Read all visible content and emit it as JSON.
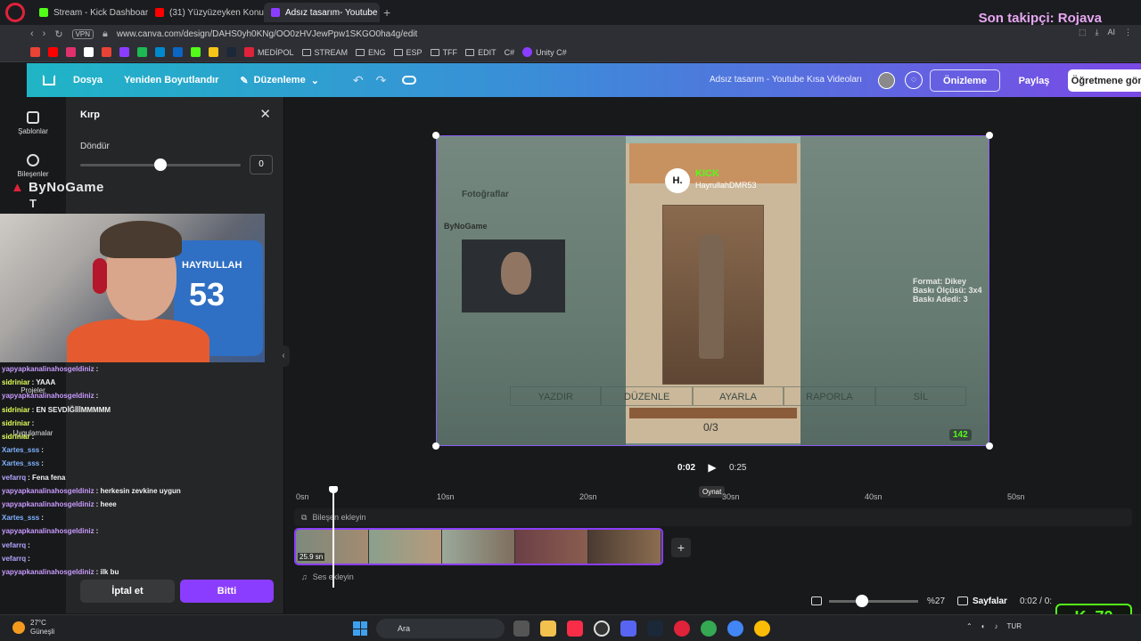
{
  "browser": {
    "tabs": [
      {
        "label": "Stream - Kick Dashboard",
        "color": "#53fc18"
      },
      {
        "label": "(31) Yüzyüzeyken Konu",
        "color": "#ff0000"
      },
      {
        "label": "Adsız tasarım- Youtube Kı",
        "color": "#8b3dff",
        "active": true
      }
    ],
    "url": "www.canva.com/design/DAHS0yh0KNg/OO0zHVJewPpw1SKGO0ha4g/edit",
    "vpn": "VPN",
    "bookmarks": [
      "MEDİPOL",
      "STREAM",
      "ENG",
      "ESP",
      "TFF",
      "EDIT",
      "C#",
      "Unity C#"
    ],
    "right_ai": "AI"
  },
  "overlay": {
    "follower": "Son takipçi: Rojava",
    "brand": "ByNoGame",
    "kick_viewers": "72"
  },
  "header": {
    "file": "Dosya",
    "resize": "Yeniden Boyutlandır",
    "edit": "Düzenleme",
    "doc_title": "Adsız tasarım - Youtube Kısa Videoları",
    "preview": "Önizleme",
    "share": "Paylaş",
    "send": "Öğretmene gönder"
  },
  "rail": {
    "templates": "Şablonlar",
    "elements": "Bileşenler",
    "projects": "Projeler",
    "apps": "Uygulamalar"
  },
  "crop_panel": {
    "title": "Kırp",
    "rotate_label": "Döndür",
    "rotate_value": "0",
    "slider_fraction": 0.5,
    "cancel": "İptal et",
    "done": "Bitti"
  },
  "webcam": {
    "jersey_name": "HAYRULLAH",
    "jersey_number": "53"
  },
  "chat": [
    {
      "user": "yapyapkanalinahosgeldiniz",
      "msg": ":",
      "color": "#c99bff"
    },
    {
      "user": "sidriniar",
      "msg": ": YAAA",
      "color": "#e4ff5a"
    },
    {
      "user": "yapyapkanalinahosgeldiniz",
      "msg": ":",
      "color": "#c99bff"
    },
    {
      "user": "sidriniar",
      "msg": ": EN SEVDİĞİİİMMMMM",
      "color": "#e4ff5a"
    },
    {
      "user": "sidriniar",
      "msg": ":",
      "color": "#e4ff5a"
    },
    {
      "user": "sidriniar",
      "msg": ":",
      "color": "#e4ff5a"
    },
    {
      "user": "Xartes_sss",
      "msg": ":",
      "color": "#7fb2ff"
    },
    {
      "user": "Xartes_sss",
      "msg": ":",
      "color": "#7fb2ff"
    },
    {
      "user": "vefarrq",
      "msg": ": Fena fena",
      "color": "#b5a6ff"
    },
    {
      "user": "yapyapkanalinahosgeldiniz",
      "msg": ": herkesin zevkine uygun",
      "color": "#c99bff"
    },
    {
      "user": "yapyapkanalinahosgeldiniz",
      "msg": ": heee",
      "color": "#c99bff"
    },
    {
      "user": "Xartes_sss",
      "msg": ":",
      "color": "#7fb2ff"
    },
    {
      "user": "yapyapkanalinahosgeldiniz",
      "msg": ":",
      "color": "#c99bff"
    },
    {
      "user": "vefarrq",
      "msg": ":",
      "color": "#b5a6ff"
    },
    {
      "user": "vefarrq",
      "msg": ":",
      "color": "#b5a6ff"
    },
    {
      "user": "yapyapkanalinahosgeldiniz",
      "msg": ": ilk bu",
      "color": "#c99bff"
    }
  ],
  "design": {
    "kick_label": "KICK",
    "kick_user": "HayrullahDMR53",
    "kick_badge": "H.",
    "photos_label": "Fotoğraflar",
    "menu": [
      "YAZDIR",
      "DÜZENLE",
      "AYARLA",
      "RAPORLA",
      "SİL"
    ],
    "counter": "0/3",
    "format_lines": [
      "Format: Dikey",
      "Baskı Ölçüsü: 3x4",
      "Baskı Adedi: 3"
    ],
    "inner_logo": "ByNoGame",
    "viewers": "142"
  },
  "playback": {
    "current": "0:02",
    "total": "0:25",
    "tooltip": "Oynat"
  },
  "timeline": {
    "ticks": [
      "0sn",
      "10sn",
      "20sn",
      "30sn",
      "40sn",
      "50sn"
    ],
    "add_element": "Bileşen ekleyin",
    "clip_duration": "25.9 sn",
    "add_audio": "Ses ekleyin"
  },
  "bottom": {
    "zoom": "%27",
    "zoom_fraction": 0.3,
    "pages": "Sayfalar",
    "time": "0:02 / 0:"
  },
  "taskbar": {
    "temp": "27°C",
    "weather": "Güneşli",
    "search": "Ara",
    "lang": "TUR"
  }
}
